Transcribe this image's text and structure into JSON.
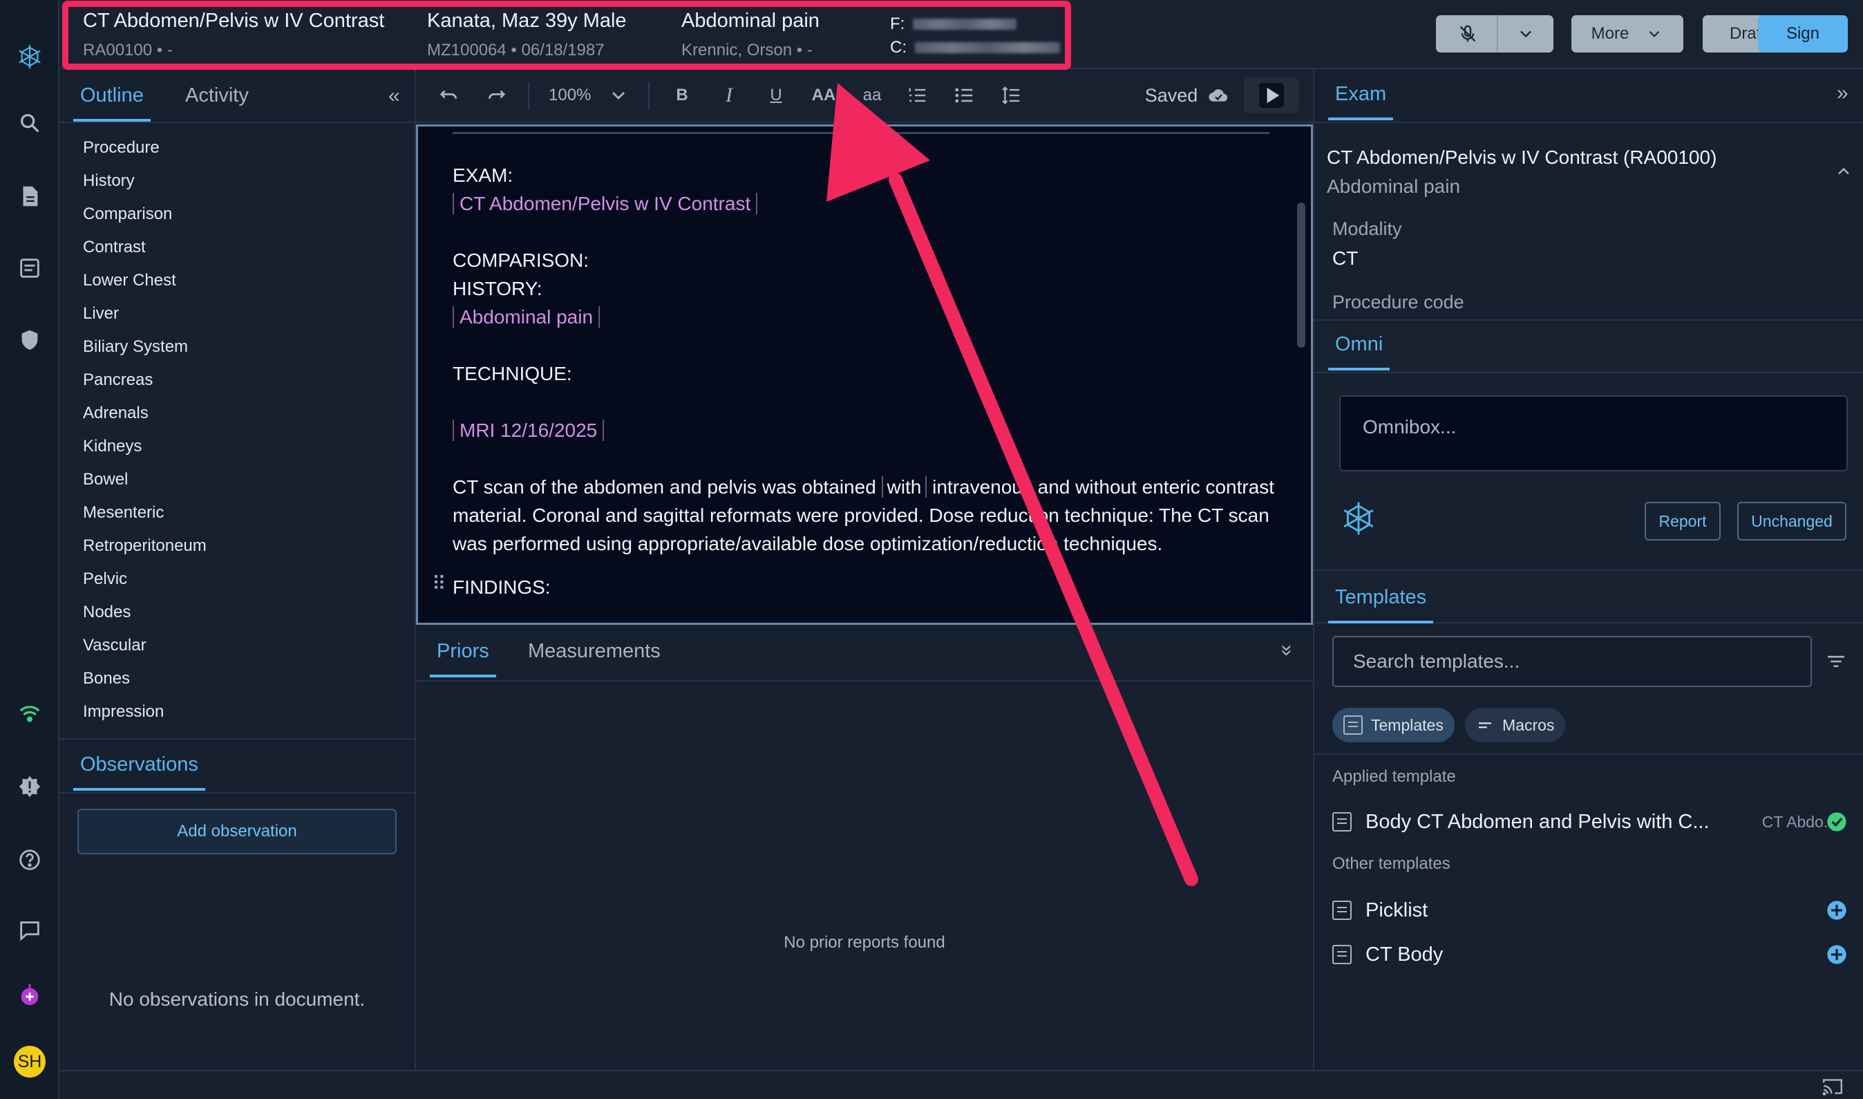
{
  "header": {
    "exam_title": "CT Abdomen/Pelvis w IV Contrast",
    "exam_sub": "RA00100 • -",
    "patient": "Kanata, Maz 39y Male",
    "patient_sub": "MZ100064 • 06/18/1987",
    "reason": "Abdominal pain",
    "physician": "Krennic, Orson • -",
    "f_label": "F:",
    "c_label": "C:",
    "more_label": "More",
    "draft_label": "Draft",
    "sign_label": "Sign"
  },
  "left": {
    "tabs": [
      "Outline",
      "Activity"
    ],
    "outline": [
      "Procedure",
      "History",
      "Comparison",
      "Contrast",
      "Lower Chest",
      "Liver",
      "Biliary System",
      "Pancreas",
      "Adrenals",
      "Kidneys",
      "Bowel",
      "Mesenteric",
      "Retroperitoneum",
      "Pelvic",
      "Nodes",
      "Vascular",
      "Bones",
      "Impression"
    ],
    "observations_title": "Observations",
    "add_observation": "Add observation",
    "no_observations": "No observations in document."
  },
  "toolbar": {
    "zoom": "100%",
    "saved": "Saved",
    "bold": "B",
    "italic": "I",
    "underline": "U",
    "upper": "AA",
    "lower": "aa"
  },
  "editor": {
    "exam_label": "EXAM:",
    "exam_value": "CT Abdomen/Pelvis w IV Contrast",
    "comparison_label": "COMPARISON:",
    "history_label": "HISTORY:",
    "history_value": "Abdominal pain",
    "technique_label": "TECHNIQUE:",
    "technique_value": "MRI 12/16/2025",
    "para1_a": "CT scan of the abdomen and pelvis was obtained ",
    "para1_ph": "with",
    "para1_b": " intravenous and without enteric contrast material. Coronal and sagittal reformats were provided. Dose reduction technique: The CT scan was performed using appropriate/available dose optimization/reduction techniques.",
    "findings_label": "FINDINGS:"
  },
  "bottom": {
    "tabs": [
      "Priors",
      "Measurements"
    ],
    "empty": "No prior reports found"
  },
  "right": {
    "exam_tab": "Exam",
    "exam_title": "CT Abdomen/Pelvis w IV Contrast (RA00100)",
    "exam_reason": "Abdominal pain",
    "modality_label": "Modality",
    "modality_value": "CT",
    "procedure_code_label": "Procedure code",
    "omni_tab": "Omni",
    "omnibox_placeholder": "Omnibox...",
    "report_btn": "Report",
    "unchanged_btn": "Unchanged",
    "templates_tab": "Templates",
    "search_placeholder": "Search templates...",
    "chip_templates": "Templates",
    "chip_macros": "Macros",
    "applied_label": "Applied template",
    "applied_name": "Body CT Abdomen and Pelvis with C...",
    "applied_meta": "CT Abdo...",
    "other_label": "Other templates",
    "other": [
      "Picklist",
      "CT Body"
    ]
  },
  "avatar_initials": "SH",
  "colors": {
    "accent": "#5ab4f0",
    "highlight": "#f1285e",
    "placeholder": "#d48fe8"
  }
}
